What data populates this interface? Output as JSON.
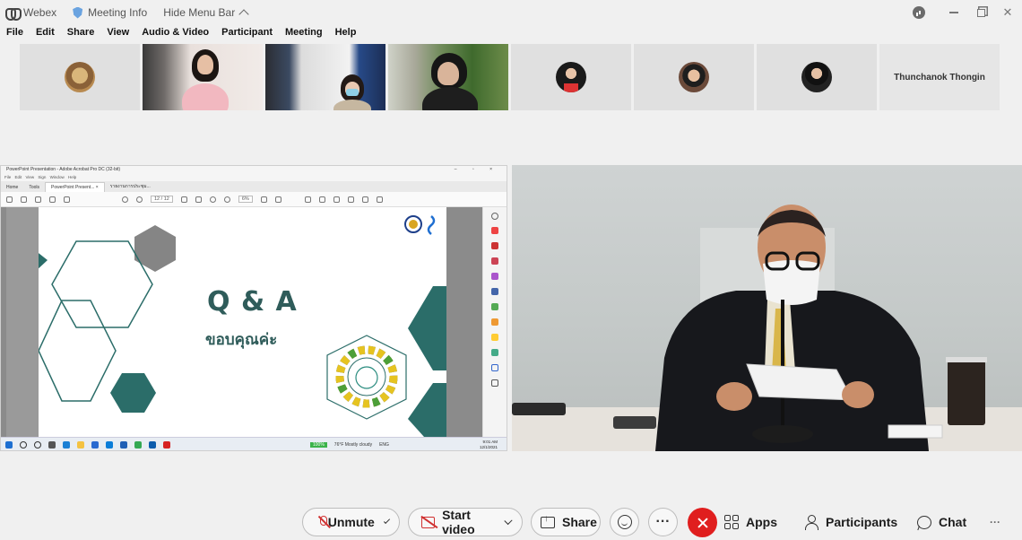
{
  "titlebar": {
    "app_name": "Webex",
    "meeting_info": "Meeting Info",
    "hide_menu_bar": "Hide Menu Bar"
  },
  "menu": [
    "File",
    "Edit",
    "Share",
    "View",
    "Audio & Video",
    "Participant",
    "Meeting",
    "Help"
  ],
  "participants": {
    "name_tile": "Thunchanok Thongin"
  },
  "shared_window": {
    "title": "PowerPoint Presentation - Adobe Acrobat Pro DC (32-bit)",
    "window_controls": "– ▫ ×",
    "menu": "File  Edit  View  Sign  Window  Help",
    "tabs": [
      "Home",
      "Tools",
      "PowerPoint Present... ×",
      "รายงานการประชุม..."
    ],
    "page_indicator": "12 / 12",
    "zoom": "6%",
    "taskbar_badge": "100%",
    "weather": "76°F  Mostly cloudy",
    "lang": "ENG",
    "time": "9:01 AM",
    "date": "12/1/2021",
    "slide": {
      "title": "Q & A",
      "subtitle": "ขอบคุณค่ะ",
      "sdg_center": "SUSTAINABLE DEVELOPMENT GOALS"
    }
  },
  "controls": {
    "unmute": "Unmute",
    "start_video": "Start video",
    "share": "Share",
    "more": "···",
    "apps": "Apps",
    "participants": "Participants",
    "chat": "Chat",
    "overflow": "···"
  },
  "colors": {
    "end_call": "#e01e1e",
    "muted_icon": "#d03030",
    "slide_teal": "#2f5c5a"
  }
}
